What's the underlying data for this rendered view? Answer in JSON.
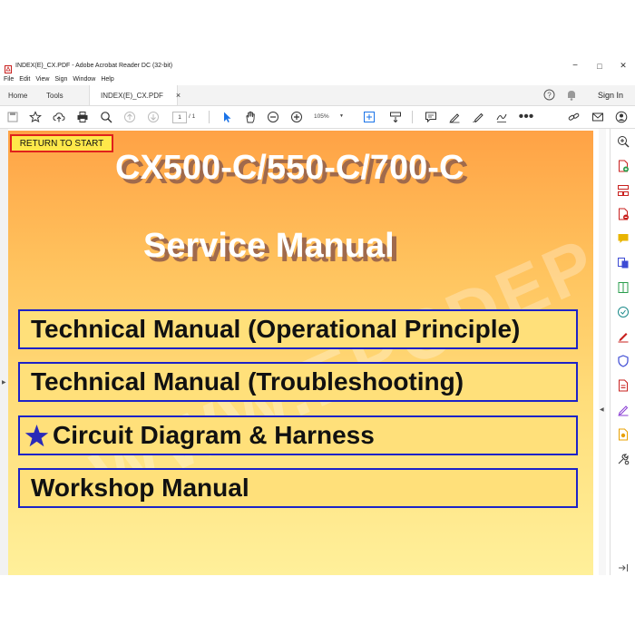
{
  "window": {
    "title": "INDEX(E)_CX.PDF - Adobe Acrobat Reader DC (32-bit)",
    "controls": {
      "minimize": "−",
      "maximize": "□",
      "close": "✕"
    }
  },
  "menu": [
    "File",
    "Edit",
    "View",
    "Sign",
    "Window",
    "Help"
  ],
  "tabs": {
    "home": "Home",
    "tools": "Tools",
    "document": "INDEX(E)_CX.PDF",
    "close": "×"
  },
  "header": {
    "sign_in": "Sign In"
  },
  "toolbar": {
    "page_current": "1",
    "page_total": "/ 1",
    "zoom": "105%",
    "more": "•••"
  },
  "document": {
    "return_label": "RETURN TO START",
    "title_line1": "CX500-C/550-C/700-C",
    "title_line2": "Service Manual",
    "watermark": "WWW.EPCDEPO.COM",
    "links": [
      {
        "label": "Technical Manual (Operational Principle)",
        "star": false
      },
      {
        "label": "Technical Manual (Troubleshooting)",
        "star": false
      },
      {
        "label": "Circuit Diagram & Harness",
        "star": true
      },
      {
        "label": "Workshop Manual",
        "star": false
      }
    ]
  },
  "colors": {
    "link_border": "#1c22c8",
    "return_border": "#e0201c",
    "star": "#2a2ab8",
    "accent_blue": "#1a73e8"
  }
}
